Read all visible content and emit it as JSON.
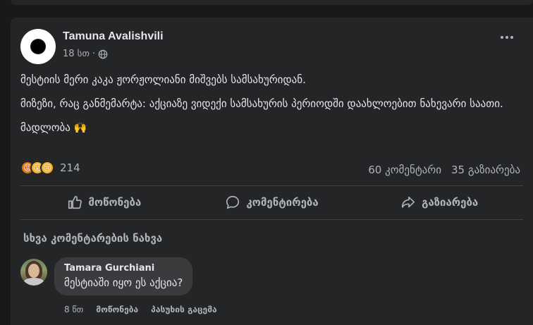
{
  "post": {
    "author": "Tamuna Avalishvili",
    "time": "18 სთ",
    "separator": "·",
    "paragraphs": [
      "მესტიის მერი კაკა ჟორჟოლიანი მიშვებს სამსახურიდან.",
      "მიზეზი, რაც განმემარტა: აქციაზე ვიდექი სამსახურის პერიოდში დაახლოებით ნახევარი საათი.",
      "მადლობა 🙌"
    ],
    "reactions": {
      "icons": [
        "angry-icon",
        "wow-icon",
        "sad-icon"
      ],
      "count": "214"
    },
    "comments_count": "60 კომენტარი",
    "shares_count": "35 გაზიარება"
  },
  "actions": {
    "like": "მოწონება",
    "comment": "კომენტირება",
    "share": "გაზიარება"
  },
  "view_more_comments": "სხვა კომენტარების ნახვა",
  "comment": {
    "author": "Tamara Gurchiani",
    "text": "მესტიაში იყო ეს აქცია?",
    "time": "8 წთ",
    "like": "მოწონება",
    "reply": "პასუხის გაცემა"
  },
  "colors": {
    "background": "#18191a",
    "card": "#242526",
    "bubble": "#3a3b3c",
    "text_primary": "#e4e6eb",
    "text_secondary": "#b0b3b8"
  }
}
